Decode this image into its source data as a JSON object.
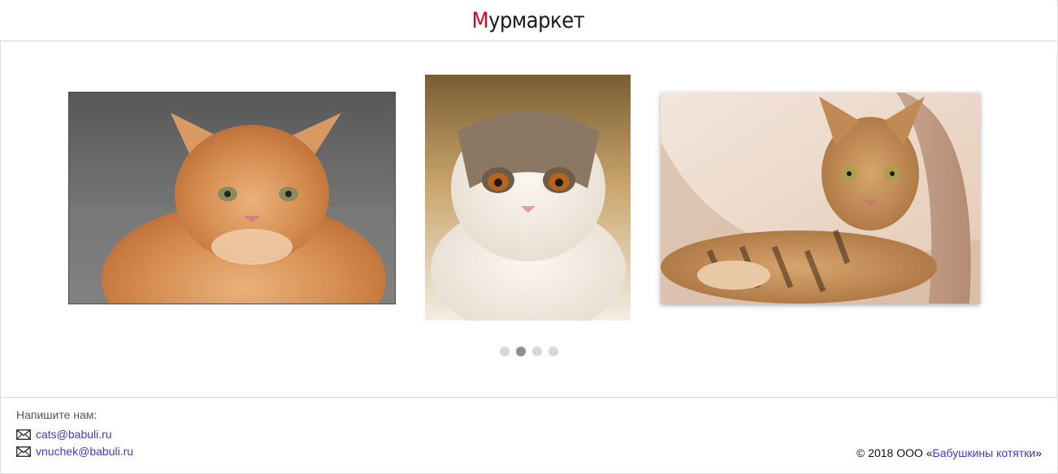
{
  "header": {
    "logo_first": "М",
    "logo_rest": "урмаркет"
  },
  "carousel": {
    "slides": [
      {
        "icon": "ginger-longhair-cat-photo"
      },
      {
        "icon": "white-fluffy-cat-photo"
      },
      {
        "icon": "bengal-cat-photo"
      }
    ],
    "dots_count": 4,
    "active_dot": 2
  },
  "footer": {
    "contact_label": "Напишите нам:",
    "emails": [
      "cats@babuli.ru",
      "vnuchek@babuli.ru"
    ],
    "copyright_prefix": "© 2018 ООО «",
    "company_name": "Бабушкины котятки",
    "copyright_suffix": "»"
  },
  "colors": {
    "logo_accent": "#e2001a",
    "link": "#3b3bd1",
    "dot": "#d8d8d8",
    "dot_active": "#8f8f8f"
  }
}
